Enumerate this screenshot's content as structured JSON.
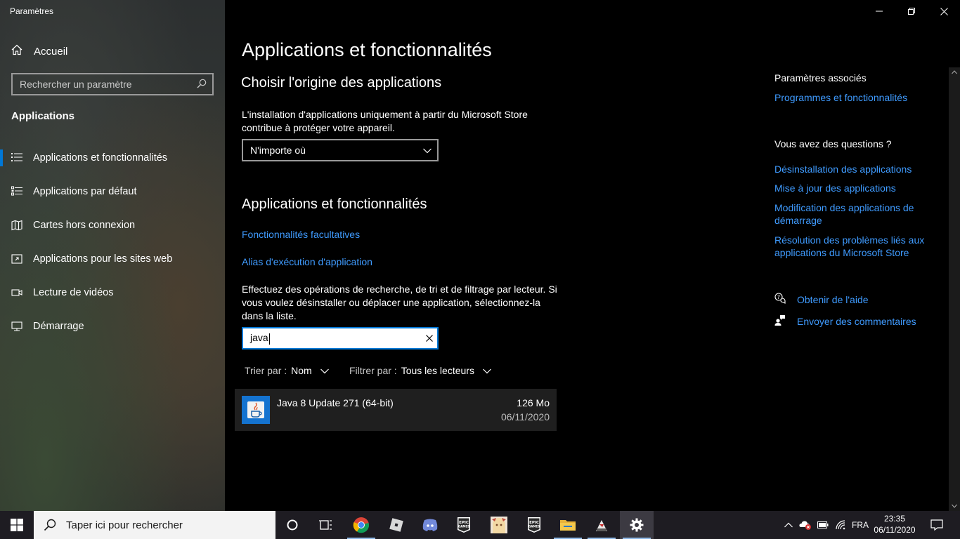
{
  "window": {
    "title": "Paramètres"
  },
  "sidebar": {
    "home_label": "Accueil",
    "search_placeholder": "Rechercher un paramètre",
    "section_label": "Applications",
    "items": [
      {
        "label": "Applications et fonctionnalités",
        "icon": "apps-list-icon",
        "active": true
      },
      {
        "label": "Applications par défaut",
        "icon": "default-apps-icon",
        "active": false
      },
      {
        "label": "Cartes hors connexion",
        "icon": "offline-maps-icon",
        "active": false
      },
      {
        "label": "Applications pour les sites web",
        "icon": "apps-for-websites-icon",
        "active": false
      },
      {
        "label": "Lecture de vidéos",
        "icon": "video-playback-icon",
        "active": false
      },
      {
        "label": "Démarrage",
        "icon": "startup-icon",
        "active": false
      }
    ]
  },
  "main": {
    "title": "Applications et fonctionnalités",
    "choose_origin": {
      "heading": "Choisir l'origine des applications",
      "description_line1": "L'installation d'applications uniquement à partir du Microsoft Store",
      "description_line2": "contribue à protéger votre appareil.",
      "dropdown_value": "N'importe où"
    },
    "apps_section": {
      "heading": "Applications et fonctionnalités",
      "link_optional_features": "Fonctionnalités facultatives",
      "link_alias": "Alias d'exécution d'application",
      "description_line1": "Effectuez des opérations de recherche, de tri et de filtrage par lecteur. Si",
      "description_line2": "vous voulez désinstaller ou déplacer une application, sélectionnez-la",
      "description_line3": "dans la liste.",
      "search_value": "java",
      "sort_label": "Trier par :",
      "sort_value": "Nom",
      "filter_label": "Filtrer par :",
      "filter_value": "Tous les lecteurs",
      "apps": [
        {
          "name": "Java 8 Update 271 (64-bit)",
          "size": "126 Mo",
          "date": "06/11/2020"
        }
      ]
    }
  },
  "related": {
    "heading": "Paramètres associés",
    "link_programs": "Programmes et fonctionnalités",
    "questions_heading": "Vous avez des questions ?",
    "links": [
      "Désinstallation des applications",
      "Mise à jour des applications",
      "Modification des applications de démarrage",
      "Résolution des problèmes liés aux applications du Microsoft Store"
    ],
    "get_help": "Obtenir de l'aide",
    "feedback": "Envoyer des commentaires"
  },
  "taskbar": {
    "search_placeholder": "Taper ici pour rechercher",
    "language": "FRA",
    "time": "23:35",
    "date": "06/11/2020",
    "apps": [
      "cortana-icon",
      "task-view-icon",
      "chrome-icon",
      "roblox-icon",
      "discord-icon",
      "epic-games-icon",
      "anime-app-icon",
      "epic-games-icon",
      "file-explorer-icon",
      "game-app-icon",
      "settings-icon"
    ],
    "epic_label": "EPIC\nGAMES"
  },
  "colors": {
    "accent": "#0078d7",
    "link": "#3f9bff"
  }
}
